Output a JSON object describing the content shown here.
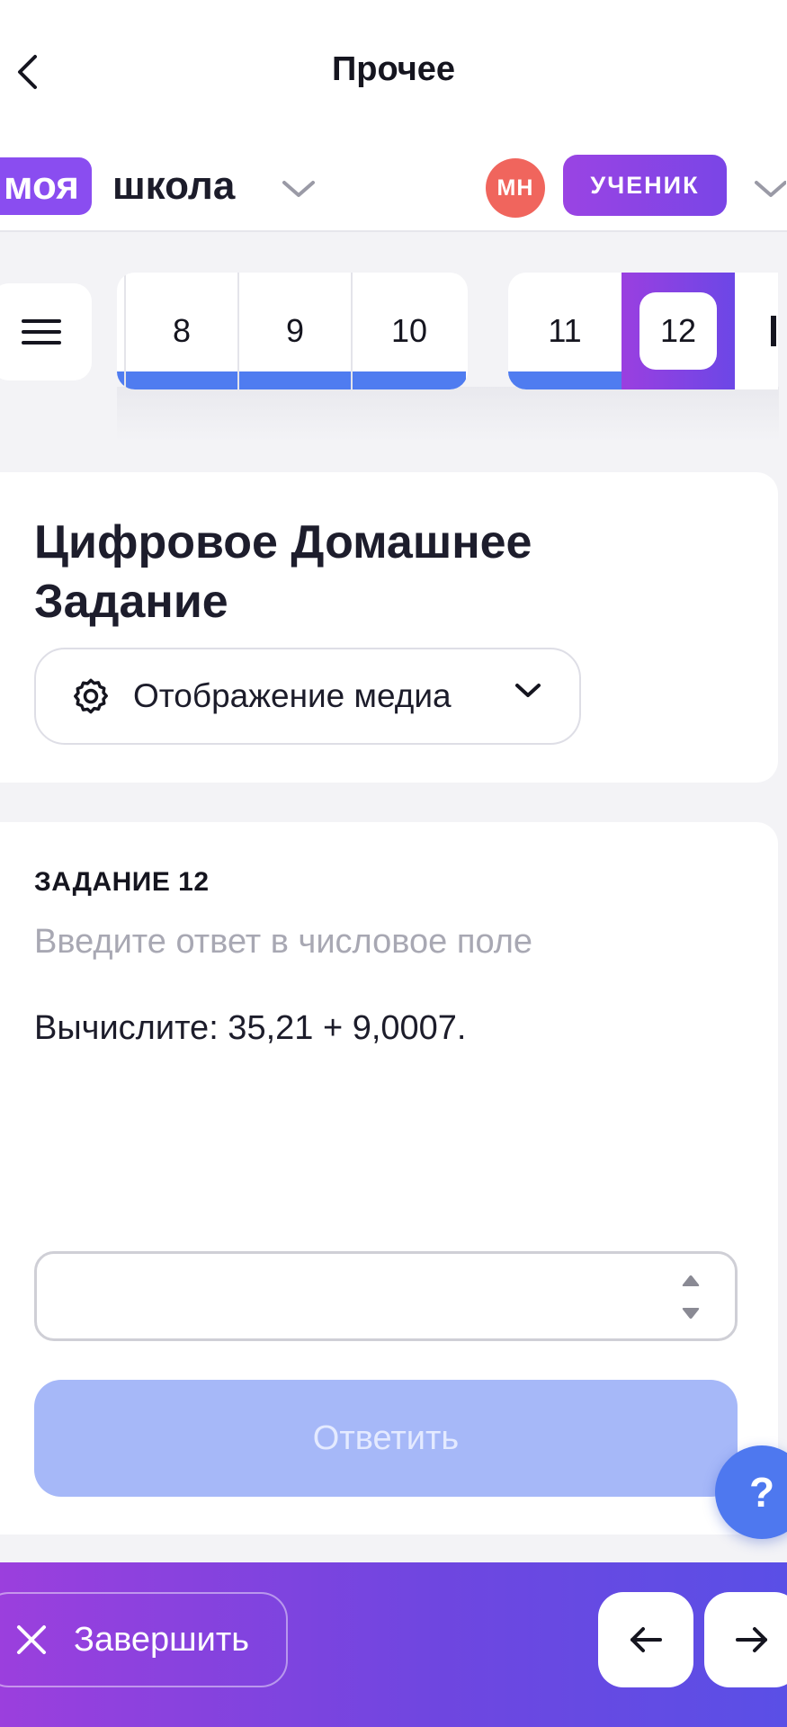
{
  "header": {
    "title": "Прочее"
  },
  "school": {
    "logo_left": "моя",
    "logo_right": "школа",
    "avatar_initials": "МН",
    "role": "УЧЕНИК"
  },
  "task_strip": {
    "tiles": [
      {
        "label": "8",
        "done": true
      },
      {
        "label": "9",
        "done": true
      },
      {
        "label": "10",
        "done": true
      },
      {
        "label": "11",
        "done": true
      },
      {
        "label": "12",
        "active": true
      }
    ],
    "accent_color": "#4f7cf0"
  },
  "homework": {
    "title": "Цифровое Домашнее Задание",
    "media_select_label": "Отображение медиа"
  },
  "task": {
    "label": "ЗАДАНИЕ 12",
    "hint": "Введите ответ в числовое поле",
    "text": "Вычислите: 35,21 + 9,0007.",
    "answer_value": "",
    "submit_label": "Ответить",
    "help_label": "?"
  },
  "footer": {
    "finish_label": "Завершить"
  },
  "colors": {
    "brand_purple": "#8a4df0",
    "primary_blue": "#4e78ef",
    "disabled_blue": "#a6b8f8",
    "avatar_red": "#f0655d"
  }
}
